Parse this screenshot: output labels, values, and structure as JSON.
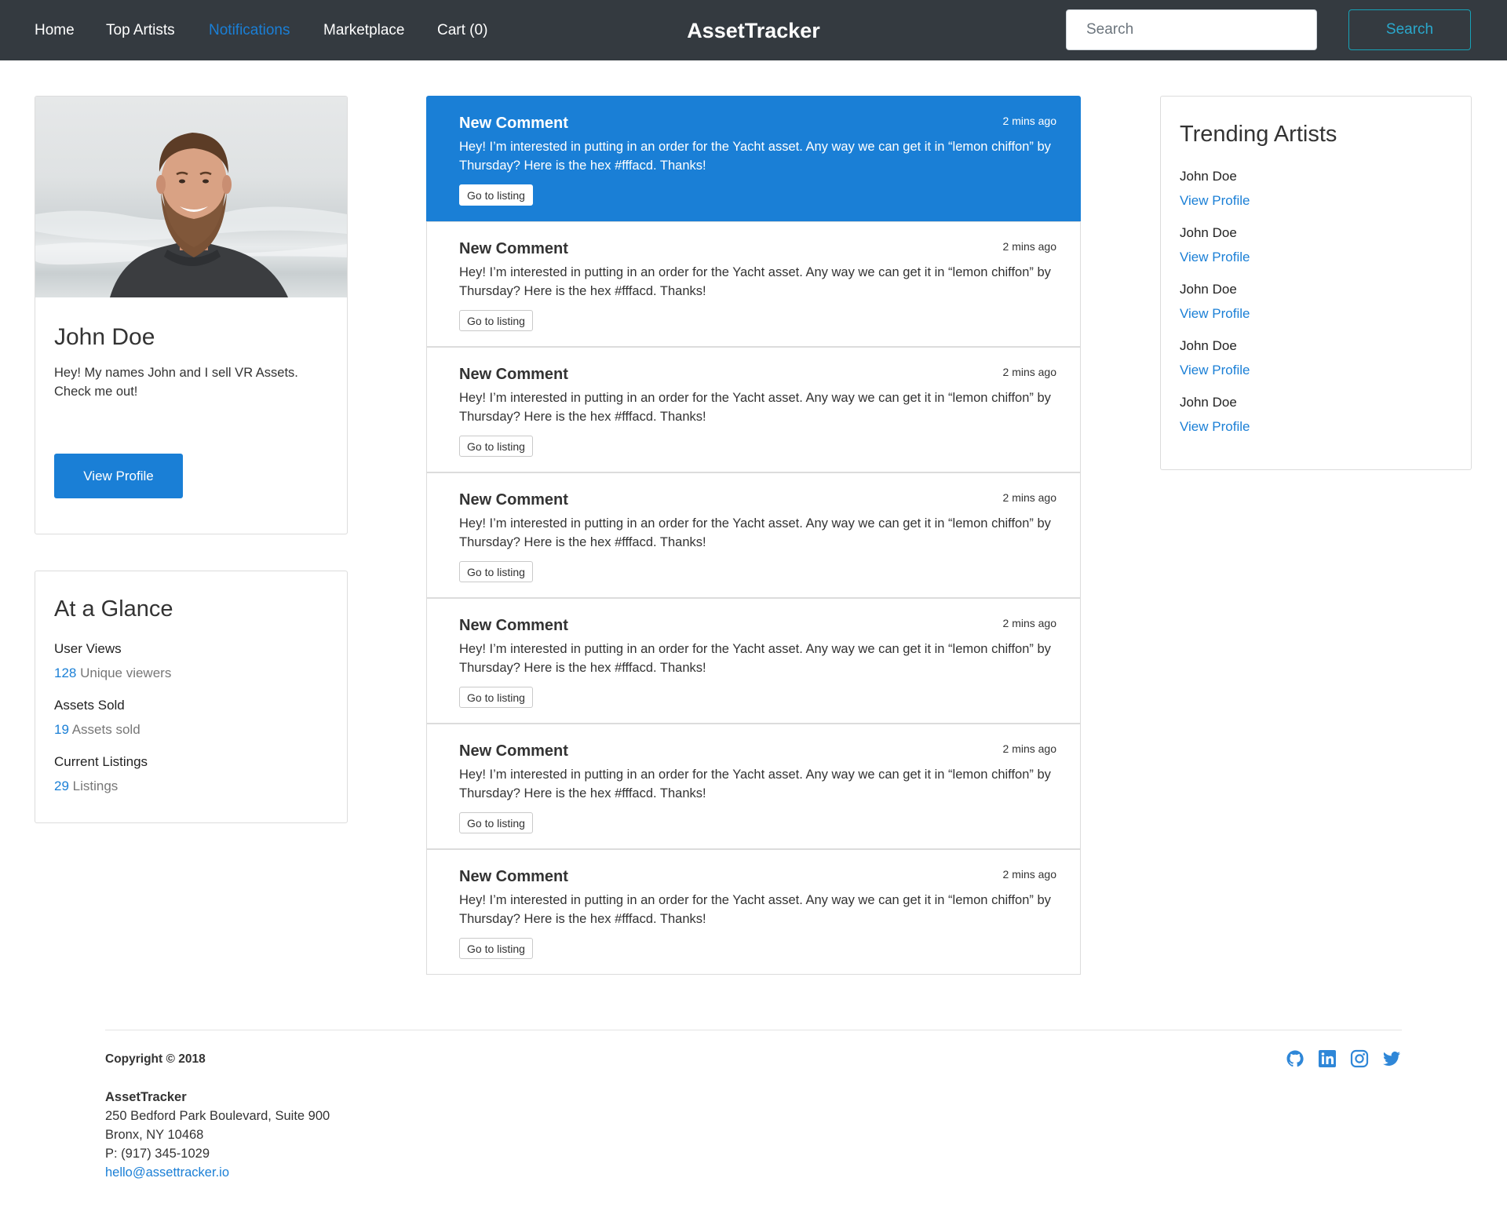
{
  "nav": {
    "links": [
      "Home",
      "Top Artists",
      "Notifications",
      "Marketplace",
      "Cart (0)"
    ],
    "active_index": 2,
    "brand": "AssetTracker",
    "search_placeholder": "Search",
    "search_button": "Search"
  },
  "profile": {
    "name": "John Doe",
    "bio": "Hey! My names John and I sell VR Assets. Check me out!",
    "button": "View Profile"
  },
  "glance": {
    "title": "At a Glance",
    "stats": [
      {
        "label": "User Views",
        "value": "128",
        "unit": "Unique viewers"
      },
      {
        "label": "Assets Sold",
        "value": "19",
        "unit": "Assets sold"
      },
      {
        "label": "Current Listings",
        "value": "29",
        "unit": "Listings"
      }
    ]
  },
  "notifications": [
    {
      "title": "New Comment",
      "time": "2 mins ago",
      "body": "Hey! I’m interested in putting in an order for the Yacht asset. Any way we can get it in “lemon chiffon” by Thursday? Here is the hex #fffacd. Thanks!",
      "button": "Go to listing"
    },
    {
      "title": "New Comment",
      "time": "2 mins ago",
      "body": "Hey! I’m interested in putting in an order for the Yacht asset. Any way we can get it in “lemon chiffon” by Thursday? Here is the hex #fffacd. Thanks!",
      "button": "Go to listing"
    },
    {
      "title": "New Comment",
      "time": "2 mins ago",
      "body": "Hey! I’m interested in putting in an order for the Yacht asset. Any way we can get it in “lemon chiffon” by Thursday? Here is the hex #fffacd. Thanks!",
      "button": "Go to listing"
    },
    {
      "title": "New Comment",
      "time": "2 mins ago",
      "body": "Hey! I’m interested in putting in an order for the Yacht asset. Any way we can get it in “lemon chiffon” by Thursday? Here is the hex #fffacd. Thanks!",
      "button": "Go to listing"
    },
    {
      "title": "New Comment",
      "time": "2 mins ago",
      "body": "Hey! I’m interested in putting in an order for the Yacht asset. Any way we can get it in “lemon chiffon” by Thursday? Here is the hex #fffacd. Thanks!",
      "button": "Go to listing"
    },
    {
      "title": "New Comment",
      "time": "2 mins ago",
      "body": "Hey! I’m interested in putting in an order for the Yacht asset. Any way we can get it in “lemon chiffon” by Thursday? Here is the hex #fffacd. Thanks!",
      "button": "Go to listing"
    },
    {
      "title": "New Comment",
      "time": "2 mins ago",
      "body": "Hey! I’m interested in putting in an order for the Yacht asset. Any way we can get it in “lemon chiffon” by Thursday? Here is the hex #fffacd. Thanks!",
      "button": "Go to listing"
    }
  ],
  "trending": {
    "title": "Trending Artists",
    "artists": [
      {
        "name": "John Doe",
        "link": "View Profile"
      },
      {
        "name": "John Doe",
        "link": "View Profile"
      },
      {
        "name": "John Doe",
        "link": "View Profile"
      },
      {
        "name": "John Doe",
        "link": "View Profile"
      },
      {
        "name": "John Doe",
        "link": "View Profile"
      }
    ]
  },
  "footer": {
    "copyright": "Copyright © 2018",
    "company": "AssetTracker",
    "address1": "250 Bedford Park Boulevard, Suite 900",
    "address2": "Bronx, NY 10468",
    "phone": "P: (917) 345-1029",
    "email": "hello@assettracker.io",
    "social_icons": [
      "github-icon",
      "linkedin-icon",
      "instagram-icon",
      "twitter-icon"
    ]
  },
  "colors": {
    "navbar": "#343a40",
    "accent": "#1a7fd6",
    "search_button": "#17a2b8"
  }
}
